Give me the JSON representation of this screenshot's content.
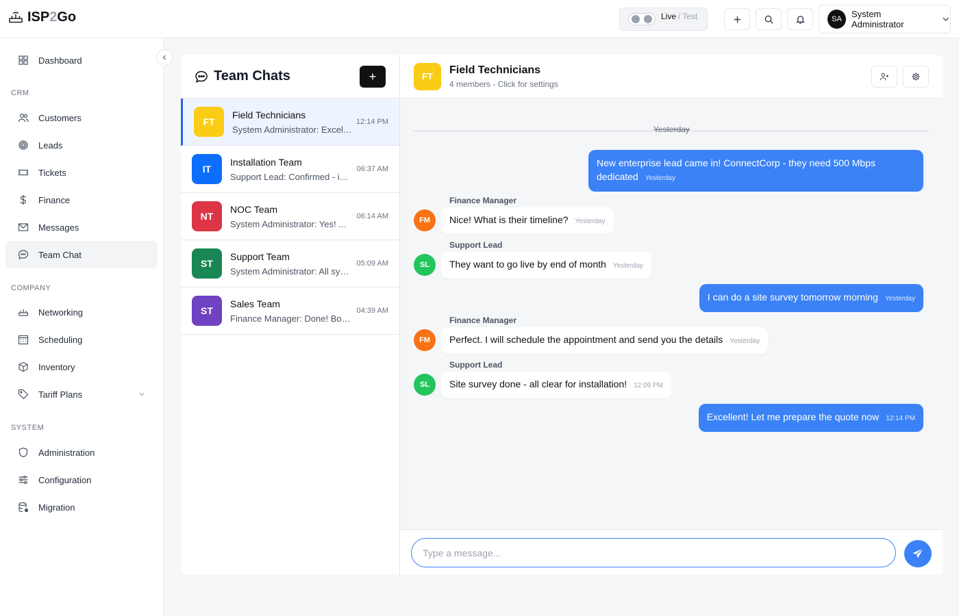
{
  "app": {
    "logo_prefix": "ISP",
    "logo_two": "2",
    "logo_suffix": "Go"
  },
  "topbar": {
    "mode_live": "Live",
    "mode_sep": "/",
    "mode_test": "Test",
    "user_initials": "SA",
    "user_name": "System Administrator"
  },
  "sidebar": {
    "dashboard": "Dashboard",
    "section_crm": "CRM",
    "customers": "Customers",
    "leads": "Leads",
    "tickets": "Tickets",
    "finance": "Finance",
    "messages": "Messages",
    "team_chat": "Team Chat",
    "section_company": "COMPANY",
    "networking": "Networking",
    "scheduling": "Scheduling",
    "inventory": "Inventory",
    "tariff_plans": "Tariff Plans",
    "section_system": "SYSTEM",
    "administration": "Administration",
    "configuration": "Configuration",
    "migration": "Migration"
  },
  "chat_list": {
    "title": "Team Chats",
    "new_label": "+",
    "items": [
      {
        "initials": "FT",
        "name": "Field Technicians",
        "preview": "System Administrator: Excellent! Let me prepare the quote now",
        "time": "12:14 PM",
        "color": "#facc15"
      },
      {
        "initials": "IT",
        "name": "Installation Team",
        "preview": "Support Lead: Confirmed - installation scheduled",
        "time": "06:37 AM",
        "color": "#0d6efd"
      },
      {
        "initials": "NT",
        "name": "NOC Team",
        "preview": "System Administrator: Yes! All links restored",
        "time": "06:14 AM",
        "color": "#dc3545"
      },
      {
        "initials": "ST",
        "name": "Support Team",
        "preview": "System Administrator: All systems operational",
        "time": "05:09 AM",
        "color": "#198754"
      },
      {
        "initials": "ST",
        "name": "Sales Team",
        "preview": "Finance Manager: Done! Booked the invoice",
        "time": "04:39 AM",
        "color": "#6f42c1"
      }
    ]
  },
  "conversation": {
    "initials": "FT",
    "title": "Field Technicians",
    "subtitle": "4 members - Click for settings",
    "day_label": "Yesterday",
    "messages": [
      {
        "type": "out",
        "text": "New enterprise lead came in! ConnectCorp - they need 500 Mbps dedicated",
        "time": "Yesterday"
      },
      {
        "type": "in",
        "sender": "Finance Manager",
        "initials": "FM",
        "text": "Nice! What is their timeline?",
        "time": "Yesterday",
        "color": "#f97316"
      },
      {
        "type": "in",
        "sender": "Support Lead",
        "initials": "SL",
        "text": "They want to go live by end of month",
        "time": "Yesterday",
        "color": "#22c55e"
      },
      {
        "type": "out",
        "text": "I can do a site survey tomorrow morning",
        "time": "Yesterday"
      },
      {
        "type": "in",
        "sender": "Finance Manager",
        "initials": "FM",
        "text": "Perfect. I will schedule the appointment and send you the details",
        "time": "Yesterday",
        "color": "#f97316"
      },
      {
        "type": "in",
        "sender": "Support Lead",
        "initials": "SL",
        "text": "Site survey done - all clear for installation!",
        "time": "12:09 PM",
        "color": "#22c55e"
      },
      {
        "type": "out",
        "text": "Excellent! Let me prepare the quote now",
        "time": "12:14 PM"
      }
    ],
    "input_placeholder": "Type a message..."
  }
}
